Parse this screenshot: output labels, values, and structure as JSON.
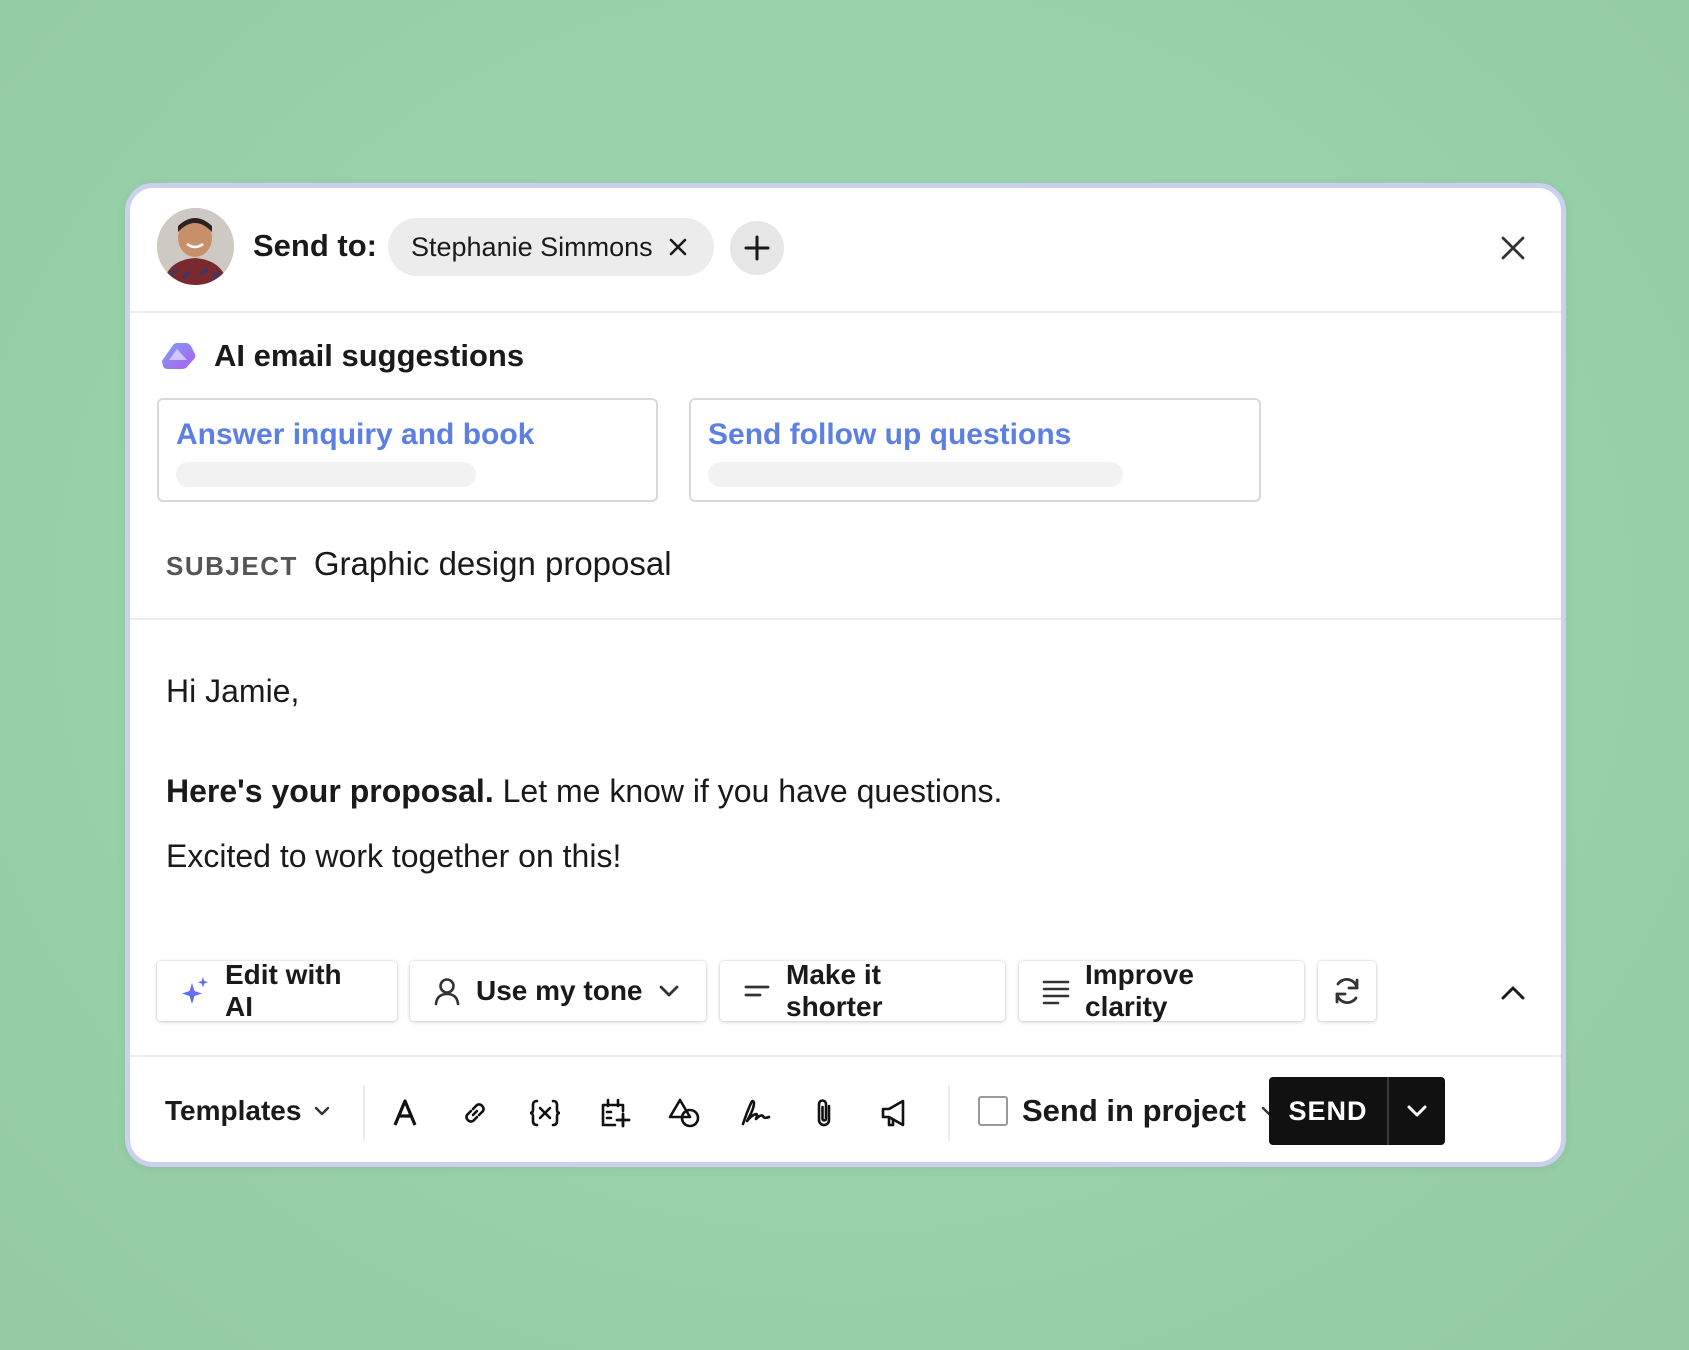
{
  "header": {
    "send_to_label": "Send to:",
    "recipient": "Stephanie Simmons",
    "icons": {
      "avatar": "avatar",
      "remove": "close-icon",
      "add": "plus-icon",
      "close": "close-icon"
    }
  },
  "suggestions": {
    "title": "AI email suggestions",
    "icon": "ai-logo-icon",
    "items": [
      {
        "label": "Answer inquiry and book"
      },
      {
        "label": "Send follow up questions"
      }
    ]
  },
  "subject": {
    "label": "SUBJECT",
    "value": "Graphic design proposal"
  },
  "body": {
    "greeting": "Hi Jamie,",
    "line1_bold": "Here's your proposal.",
    "line1_rest": " Let me know if you have questions.",
    "line2": "Excited to work together on this!"
  },
  "ai_toolbar": {
    "edit_with_ai": "Edit with AI",
    "use_my_tone": "Use my tone",
    "make_shorter": "Make it shorter",
    "improve_clarity": "Improve clarity",
    "icons": [
      "sparkle-icon",
      "person-icon",
      "short-lines-icon",
      "lines-icon",
      "refresh-icon",
      "chevron-up-icon"
    ]
  },
  "bottom_bar": {
    "templates": "Templates",
    "format_icons": [
      "text-format-icon",
      "link-icon",
      "variable-icon",
      "schedule-icon",
      "shapes-icon",
      "signature-icon",
      "attachment-icon",
      "megaphone-icon"
    ],
    "send_in_project": "Send in project",
    "send": "SEND"
  },
  "colors": {
    "background": "#98d2aa",
    "accent_blue": "#5b7fe3",
    "ai_gradient": [
      "#6c8cf0",
      "#b45cf0"
    ],
    "send_button": "#111111"
  }
}
